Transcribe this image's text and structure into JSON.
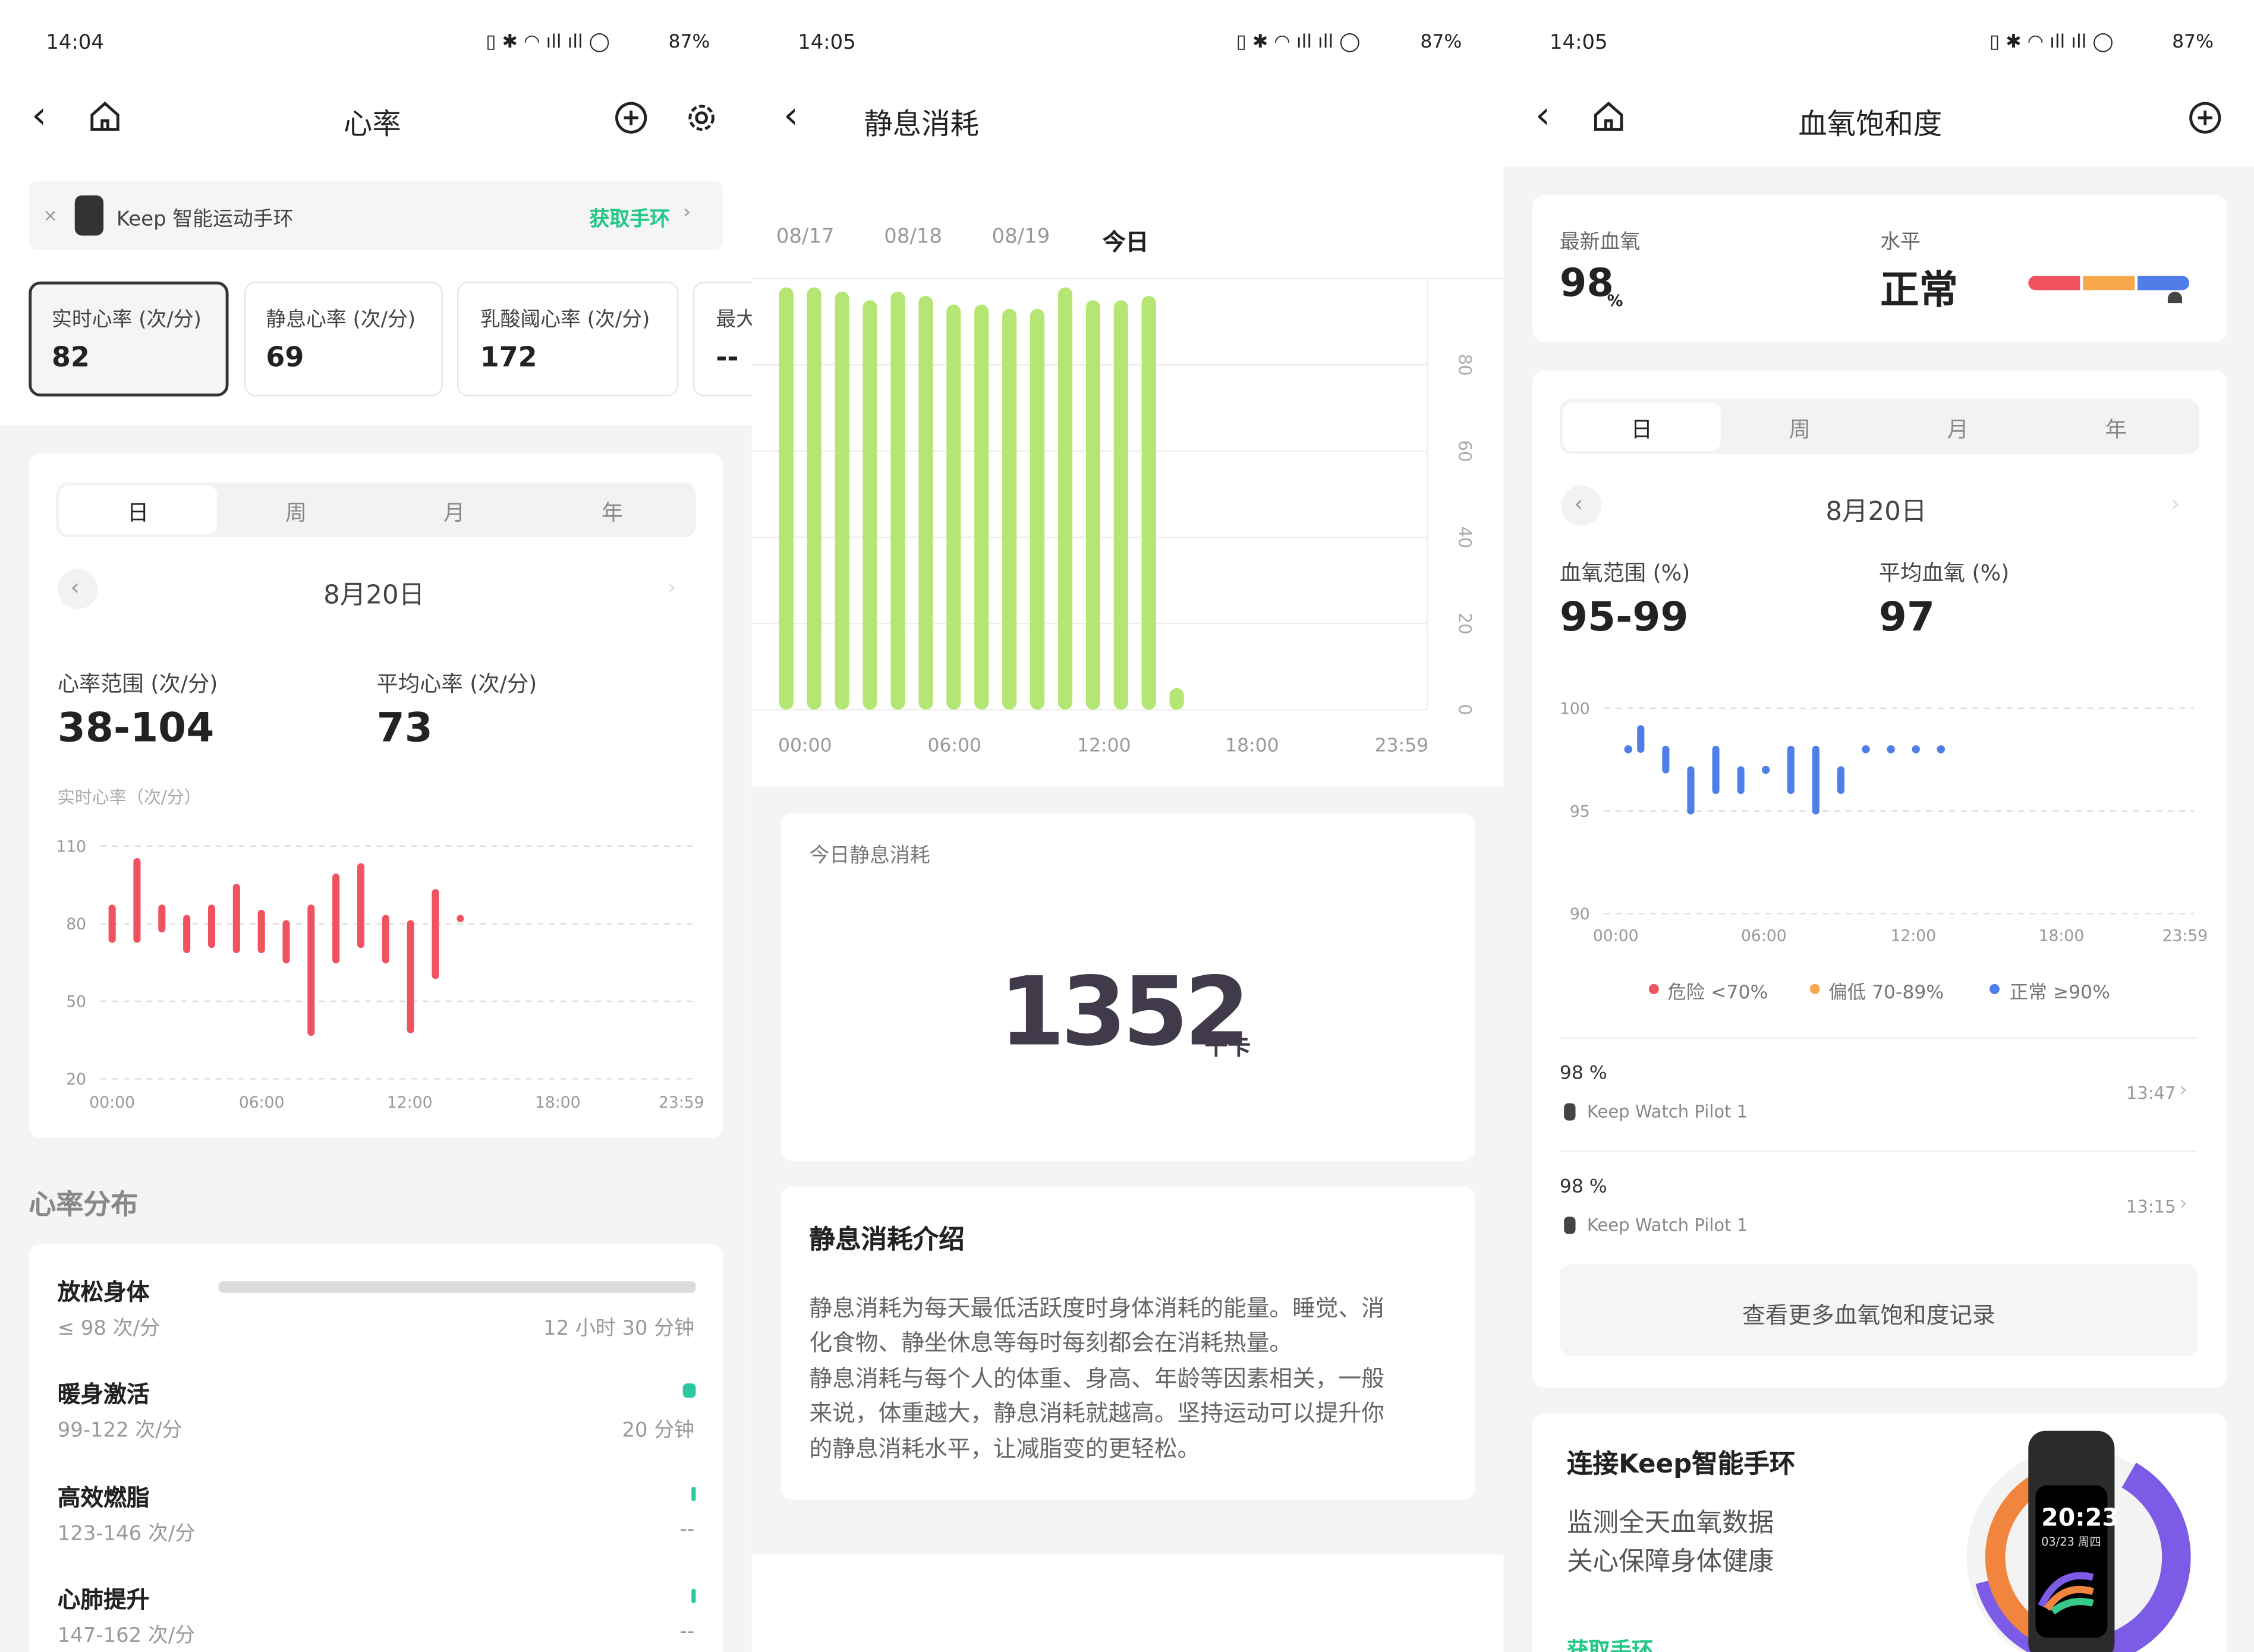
{
  "panel1": {
    "status": {
      "time": "14:04",
      "battery": "87%"
    },
    "title": "心率",
    "banner": {
      "product": "Keep 智能运动手环",
      "cta": "获取手环"
    },
    "metrics": [
      {
        "label": "实时心率 (次/分)",
        "value": "82"
      },
      {
        "label": "静息心率 (次/分)",
        "value": "69"
      },
      {
        "label": "乳酸阈心率 (次/分)",
        "value": "172"
      },
      {
        "label": "最大",
        "value": "--"
      }
    ],
    "tabs": [
      "日",
      "周",
      "月",
      "年"
    ],
    "date": "8月20日",
    "range_label": "心率范围 (次/分)",
    "range_value": "38-104",
    "avg_label": "平均心率 (次/分)",
    "avg_value": "73",
    "chart_title": "实时心率（次/分）",
    "dist_title": "心率分布",
    "dist": [
      {
        "name": "放松身体",
        "range": "≤ 98 次/分",
        "duration": "12 小时 30 分钟",
        "fraction": 1.0
      },
      {
        "name": "暖身激活",
        "range": "99-122 次/分",
        "duration": "20 分钟",
        "fraction": 0.027
      },
      {
        "name": "高效燃脂",
        "range": "123-146 次/分",
        "duration": "--",
        "fraction": 0.0
      },
      {
        "name": "心肺提升",
        "range": "147-162 次/分",
        "duration": "--",
        "fraction": 0.0
      }
    ]
  },
  "panel2": {
    "status": {
      "time": "14:05",
      "battery": "87%"
    },
    "title": "静息消耗",
    "dates": [
      "08/17",
      "08/18",
      "08/19",
      "今日"
    ],
    "card_title": "今日静息消耗",
    "value": "1352",
    "unit": "千卡",
    "intro_title": "静息消耗介绍",
    "intro_lines": [
      "静息消耗为每天最低活跃度时身体消耗的能量。睡觉、消",
      "化食物、静坐休息等每时每刻都会在消耗热量。",
      "静息消耗与每个人的体重、身高、年龄等因素相关，一般",
      "来说，体重越大，静息消耗就越高。坚持运动可以提升你",
      "的静息消耗水平，让减脂变的更轻松。"
    ]
  },
  "panel3": {
    "status": {
      "time": "14:05",
      "battery": "87%"
    },
    "title": "血氧饱和度",
    "latest_label": "最新血氧",
    "latest_value": "98",
    "latest_unit": "%",
    "level_label": "水平",
    "level_value": "正常",
    "tabs": [
      "日",
      "周",
      "月",
      "年"
    ],
    "date": "8月20日",
    "range_label": "血氧范围 (%)",
    "range_value": "95-99",
    "avg_label": "平均血氧 (%)",
    "avg_value": "97",
    "legend": [
      {
        "label": "危险 <70%",
        "color": "#f0525f"
      },
      {
        "label": "偏低 70-89%",
        "color": "#f7a84a"
      },
      {
        "label": "正常 ≥90%",
        "color": "#4f7ee8"
      }
    ],
    "records": [
      {
        "value": "98 %",
        "device": "Keep Watch Pilot 1",
        "time": "13:47"
      },
      {
        "value": "98 %",
        "device": "Keep Watch Pilot 1",
        "time": "13:15"
      }
    ],
    "more_button": "查看更多血氧饱和度记录",
    "promo_title": "连接Keep智能手环",
    "promo_line1": "监测全天血氧数据",
    "promo_line2": "关心保障身体健康",
    "promo_cta": "获取手环",
    "watch_time": "20:23",
    "watch_date": "03/23 周四"
  },
  "chart_data": [
    {
      "type": "bar",
      "title": "实时心率（次/分）",
      "x_ticks": [
        "00:00",
        "06:00",
        "12:00",
        "18:00",
        "23:59"
      ],
      "y_ticks": [
        110,
        80,
        50,
        20
      ],
      "ylim": [
        20,
        110
      ],
      "color": "#f0525f",
      "ranges": [
        {
          "x": 0.0,
          "lo": 74,
          "hi": 86
        },
        {
          "x": 1.0,
          "lo": 74,
          "hi": 104
        },
        {
          "x": 2.0,
          "lo": 78,
          "hi": 86
        },
        {
          "x": 3.0,
          "lo": 70,
          "hi": 82
        },
        {
          "x": 4.0,
          "lo": 72,
          "hi": 86
        },
        {
          "x": 5.0,
          "lo": 70,
          "hi": 94
        },
        {
          "x": 6.0,
          "lo": 70,
          "hi": 84
        },
        {
          "x": 7.0,
          "lo": 66,
          "hi": 80
        },
        {
          "x": 8.0,
          "lo": 38,
          "hi": 86
        },
        {
          "x": 9.0,
          "lo": 66,
          "hi": 98
        },
        {
          "x": 10.0,
          "lo": 72,
          "hi": 102
        },
        {
          "x": 11.0,
          "lo": 66,
          "hi": 82
        },
        {
          "x": 12.0,
          "lo": 39,
          "hi": 80
        },
        {
          "x": 13.0,
          "lo": 60,
          "hi": 92
        },
        {
          "x": 14.0,
          "lo": 82,
          "hi": 82
        }
      ]
    },
    {
      "type": "bar",
      "title": "静息消耗",
      "x_ticks": [
        "00:00",
        "06:00",
        "12:00",
        "18:00",
        "23:59"
      ],
      "y_ticks": [
        80,
        60,
        40,
        20,
        0
      ],
      "ylim": [
        0,
        100
      ],
      "color": "#b5e673",
      "categories": [
        "0",
        "1",
        "2",
        "3",
        "4",
        "5",
        "6",
        "7",
        "8",
        "9",
        "10",
        "11",
        "12",
        "13",
        "14"
      ],
      "values": [
        98,
        98,
        97,
        95,
        97,
        96,
        94,
        94,
        93,
        93,
        98,
        95,
        95,
        96,
        5
      ]
    },
    {
      "type": "bar",
      "title": "血氧饱和度",
      "x_ticks": [
        "00:00",
        "06:00",
        "12:00",
        "18:00",
        "23:59"
      ],
      "y_ticks": [
        100,
        95,
        90
      ],
      "ylim": [
        90,
        100
      ],
      "color": "#4f7ee8",
      "ranges": [
        {
          "x": 0.5,
          "lo": 98,
          "hi": 98
        },
        {
          "x": 1.0,
          "lo": 98,
          "hi": 99
        },
        {
          "x": 2.0,
          "lo": 97,
          "hi": 98
        },
        {
          "x": 3.0,
          "lo": 95,
          "hi": 97
        },
        {
          "x": 4.0,
          "lo": 96,
          "hi": 98
        },
        {
          "x": 5.0,
          "lo": 96,
          "hi": 97
        },
        {
          "x": 6.0,
          "lo": 97,
          "hi": 97
        },
        {
          "x": 7.0,
          "lo": 96,
          "hi": 98
        },
        {
          "x": 8.0,
          "lo": 95,
          "hi": 98
        },
        {
          "x": 9.0,
          "lo": 96,
          "hi": 97
        },
        {
          "x": 10.0,
          "lo": 98,
          "hi": 98
        },
        {
          "x": 11.0,
          "lo": 98,
          "hi": 98
        },
        {
          "x": 12.0,
          "lo": 98,
          "hi": 98
        },
        {
          "x": 13.0,
          "lo": 98,
          "hi": 98
        }
      ]
    }
  ]
}
